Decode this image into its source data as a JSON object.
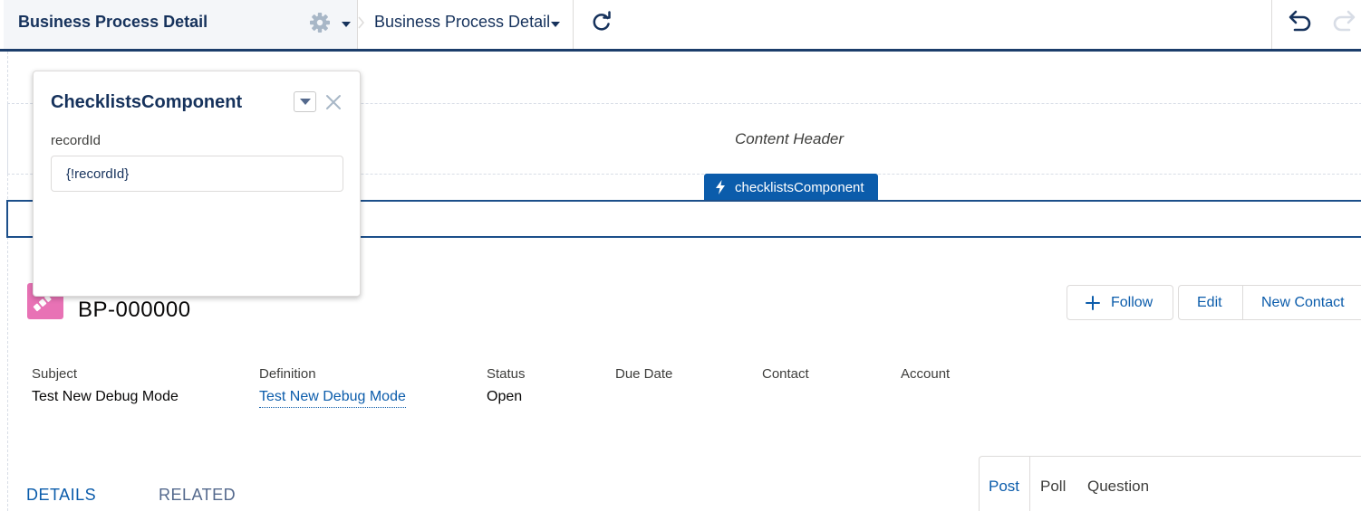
{
  "topbar": {
    "title": "Business Process Detail",
    "page_selector": "Business Process Detail",
    "icons": {
      "settings": "gear-icon",
      "settings_caret": "caret-down-icon",
      "breadcrumb": "chevron-right-icon",
      "page_caret": "caret-down-icon",
      "refresh": "refresh-icon",
      "undo": "undo-icon",
      "redo": "redo-icon"
    }
  },
  "canvas": {
    "content_header": "Content Header",
    "selected_component_tab": "checklistsComponent",
    "selected_component_icon": "lightning-bolt-icon"
  },
  "record": {
    "title": "BP-000000",
    "icon": "business-process-icon",
    "icon_color": "#e872b5",
    "actions": {
      "follow": "Follow",
      "edit": "Edit",
      "new_contact": "New Contact"
    },
    "fields": [
      {
        "label": "Subject",
        "value": "Test New Debug Mode"
      },
      {
        "label": "Definition",
        "value": "Test New Debug Mode"
      },
      {
        "label": "Status",
        "value": "Open"
      },
      {
        "label": "Due Date",
        "value": ""
      },
      {
        "label": "Contact",
        "value": ""
      },
      {
        "label": "Account",
        "value": ""
      }
    ]
  },
  "tabs": {
    "details": "DETAILS",
    "related": "RELATED"
  },
  "publisher": {
    "post": "Post",
    "poll": "Poll",
    "question": "Question"
  },
  "property_panel": {
    "title": "ChecklistsComponent",
    "field_label": "recordId",
    "field_value": "{!recordId}"
  },
  "colors": {
    "brand_blue": "#0b5cab",
    "nav_dark": "#1c3d6b",
    "text_dark": "#16325c"
  }
}
